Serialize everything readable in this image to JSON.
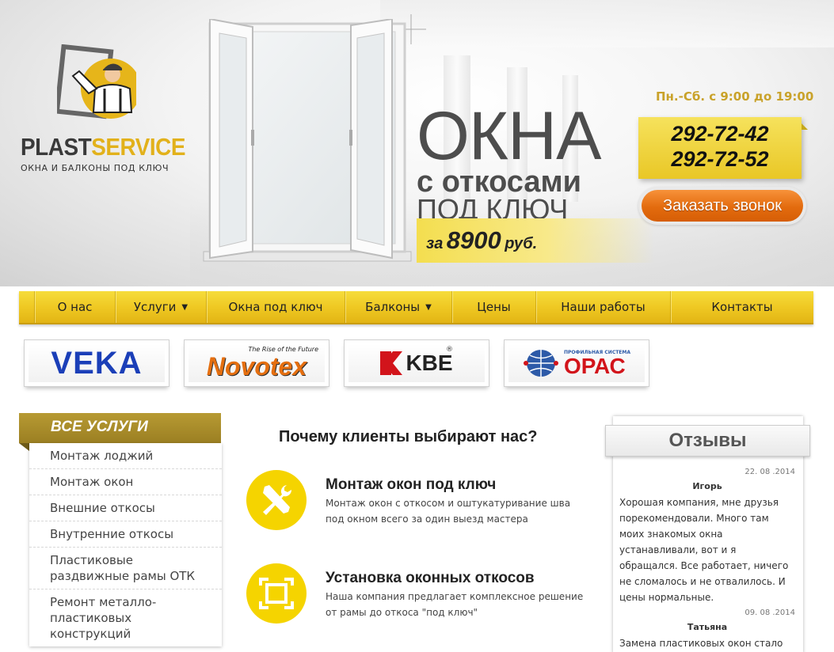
{
  "logo": {
    "name_part1": "PLAST",
    "name_part2": "SERVICE",
    "tagline": "ОКНА И БАЛКОНЫ ПОД КЛЮЧ"
  },
  "promo": {
    "line1": "ОКНА",
    "line2": "с откосами",
    "line3": "ПОД КЛЮЧ",
    "price_prefix": "за",
    "price": "8900",
    "price_suffix": "руб."
  },
  "contacts": {
    "hours": "Пн.-Сб. с 9:00 до 19:00",
    "phone1": "292-72-42",
    "phone2": "292-72-52",
    "callback_label": "Заказать звонок"
  },
  "nav": {
    "items": [
      {
        "label": "О нас"
      },
      {
        "label": "Услуги",
        "dropdown": true
      },
      {
        "label": "Окна под ключ"
      },
      {
        "label": "Балконы",
        "dropdown": true
      },
      {
        "label": "Цены"
      },
      {
        "label": "Наши работы"
      },
      {
        "label": "Контакты"
      }
    ],
    "caret": "▼"
  },
  "brands": {
    "veka": "VEKA",
    "novotex_tagline": "The Rise of the Future",
    "novotex": "Novotex",
    "kbe": "KBE",
    "kbe_reg": "®",
    "opac_small": "ПРОФИЛЬНАЯ СИСТЕМА",
    "opac": "ОРАС"
  },
  "sidebar": {
    "title": "ВСЕ УСЛУГИ",
    "items": [
      "Монтаж лоджий",
      "Монтаж окон",
      "Внешние откосы",
      "Внутренние откосы",
      "Пластиковые раздвижные рамы ОТК",
      "Ремонт металло-пластиковых конструкций"
    ]
  },
  "why": {
    "title": "Почему клиенты выбирают нас?",
    "features": [
      {
        "title": "Монтаж окон под ключ",
        "text": "Монтаж окон с откосом и оштукатуривание шва под окном всего за один выезд мастера",
        "icon": "tools-icon"
      },
      {
        "title": "Установка оконных откосов",
        "text": "Наша компания предлагает комплексное решение от рамы до откоса \"под ключ\"",
        "icon": "frame-icon"
      }
    ]
  },
  "reviews": {
    "title": "Отзывы",
    "items": [
      {
        "date": "22. 08 .2014",
        "name": "Игорь",
        "text": "Хорошая компания, мне друзья порекомендовали. Много там моих знакомых окна устанавливали, вот и я обращался. Все работает, ничего не сломалось и не отвалилось. И цены нормальные."
      },
      {
        "date": "09. 08 .2014",
        "name": "Татьяна",
        "text": "Замена пластиковых окон стало"
      }
    ]
  },
  "colors": {
    "accent_yellow": "#efc923",
    "button_orange": "#e36b0e",
    "sidebar_olive": "#a88b2a"
  }
}
